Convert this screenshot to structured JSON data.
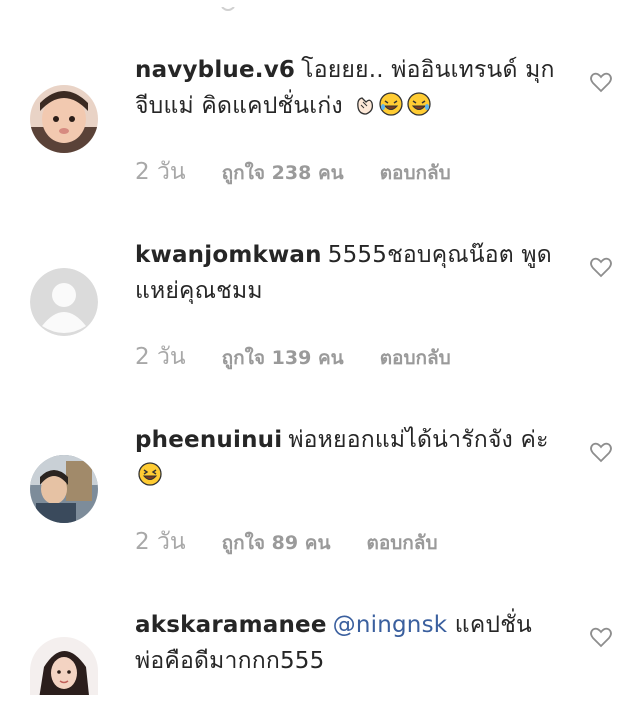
{
  "comments": [
    {
      "username": "navyblue.v6",
      "text": "โอยยย.. พ่ออินเทรนด์ มุกจีบแม่ คิดแคปชั่นเก่ง",
      "emojis": [
        "clapping-hands-icon",
        "rofl-face-icon",
        "rofl-face-icon"
      ],
      "time": "2 วัน",
      "likes": "ถูกใจ 238 คน",
      "reply": "ตอบกลับ"
    },
    {
      "username": "kwanjomkwan",
      "text": "5555ชอบคุณน๊อต พูดแหย่คุณชมม",
      "emojis": [],
      "time": "2 วัน",
      "likes": "ถูกใจ 139 คน",
      "reply": "ตอบกลับ"
    },
    {
      "username": "pheenuinui",
      "text": "พ่อหยอกแม่ได้น่ารักจัง ค่ะ",
      "emojis": [
        "laughing-face-icon"
      ],
      "time": "2 วัน",
      "likes": "ถูกใจ 89 คน",
      "reply": "ตอบกลับ"
    },
    {
      "username": "akskaramanee",
      "mention": "@ningnsk",
      "text": "แคปชั่น พ่อคือดีมากกก555",
      "emojis": []
    }
  ],
  "colors": {
    "text": "#262626",
    "meta": "#8e8e8e",
    "mention": "#3a5f9e",
    "heart_stroke": "#8e8e8e"
  }
}
